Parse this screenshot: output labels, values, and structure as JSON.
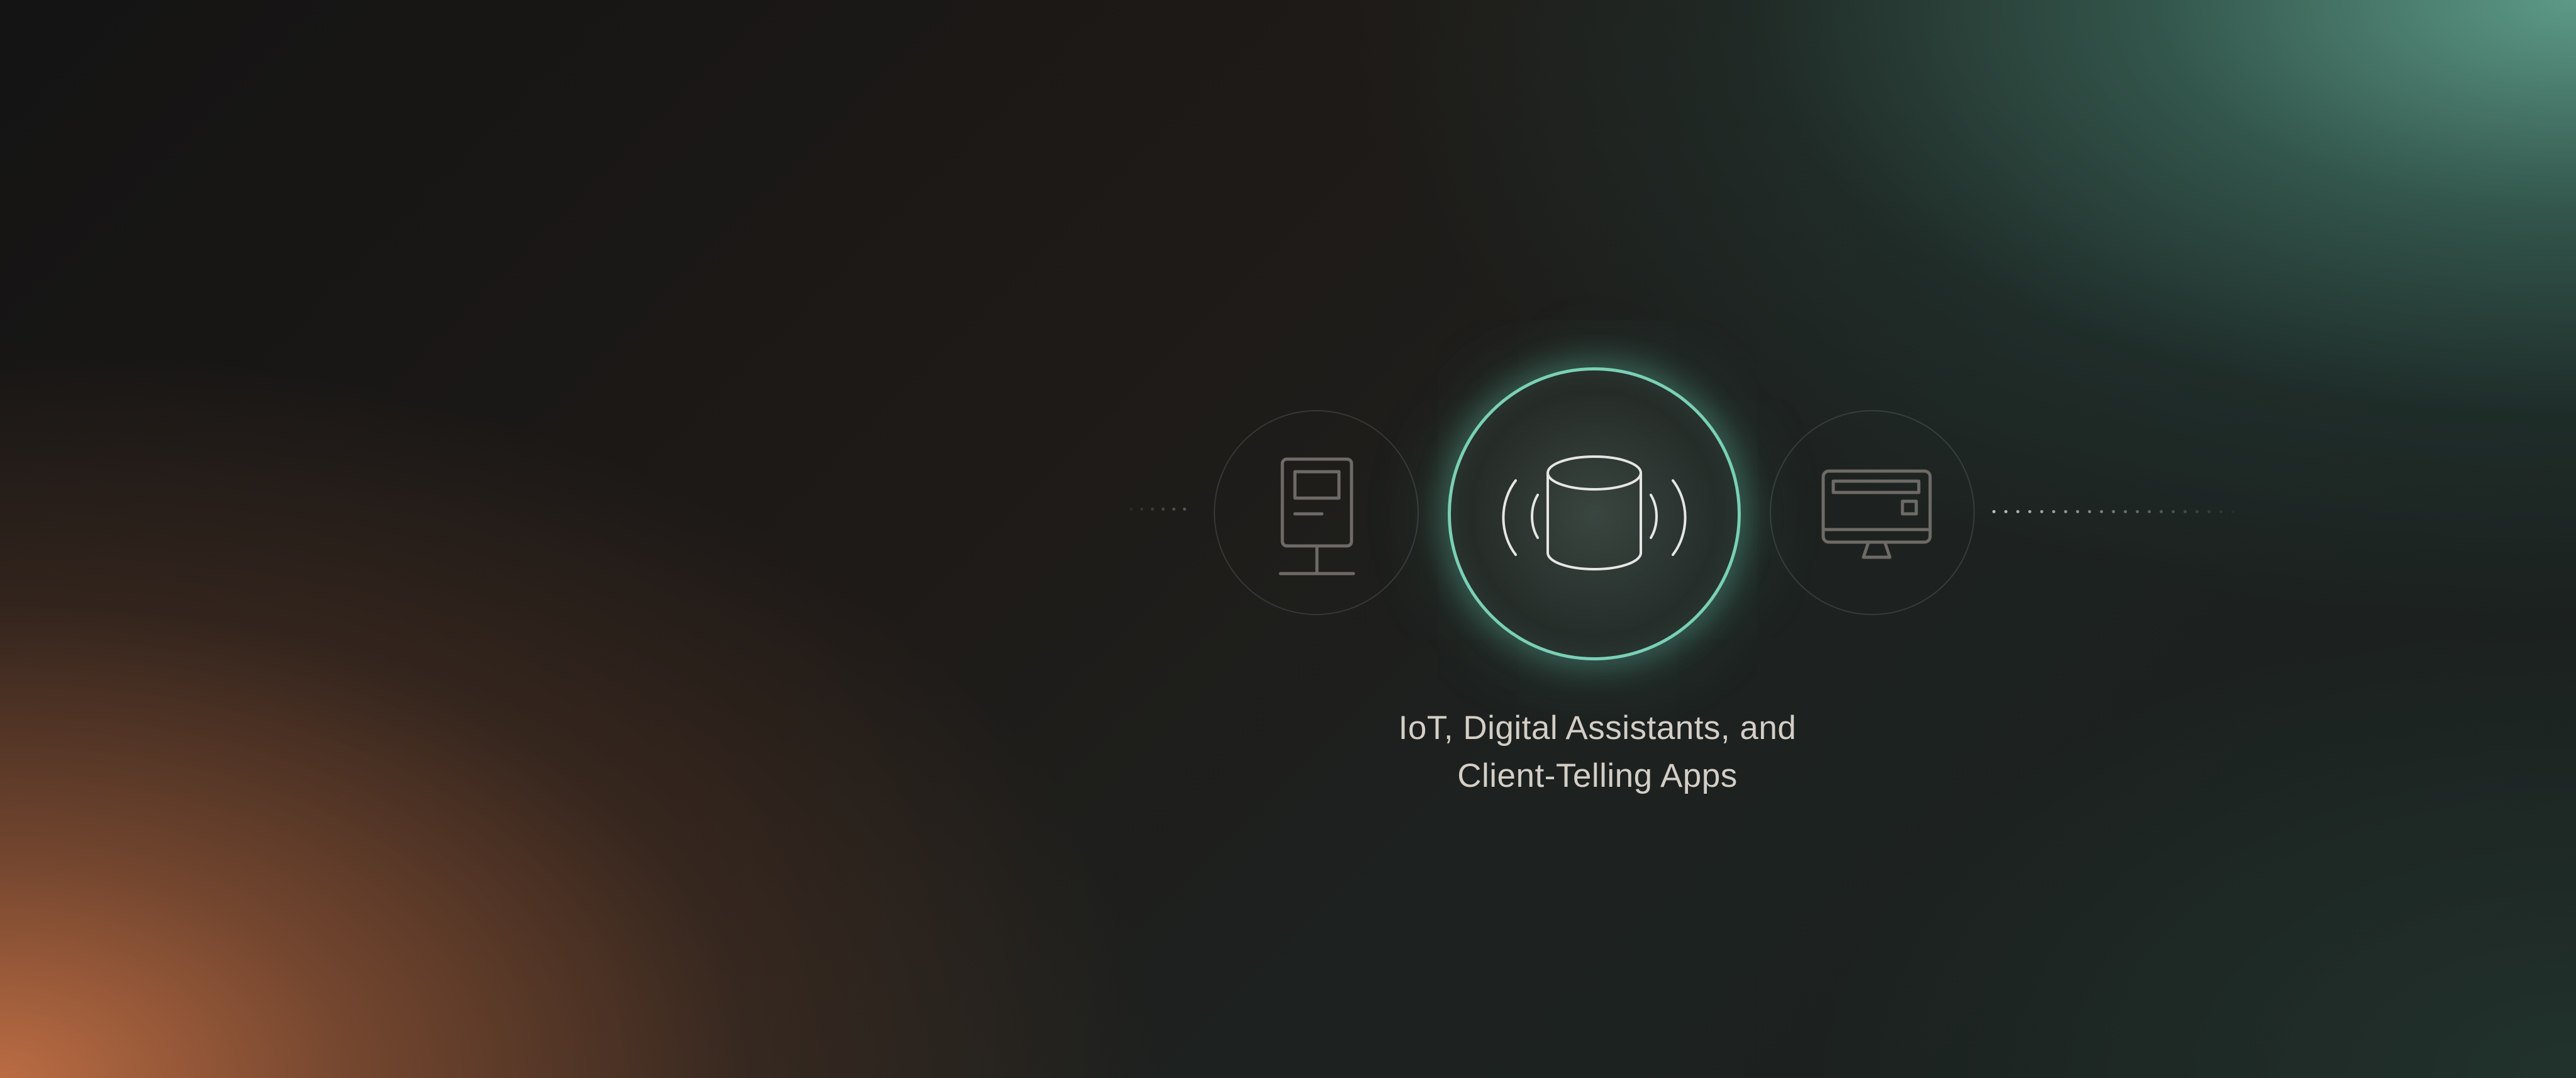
{
  "caption": {
    "line1": "IoT, Digital Assistants, and",
    "line2": "Client-Telling Apps"
  },
  "icons": {
    "left": "kiosk-icon",
    "center": "smart-speaker-icon",
    "right": "desktop-monitor-icon"
  },
  "colors": {
    "accent": "#7ad1b5",
    "text": "#d4cec6",
    "icon_muted": "#6e6a66",
    "icon_active": "#e6e6e4"
  }
}
